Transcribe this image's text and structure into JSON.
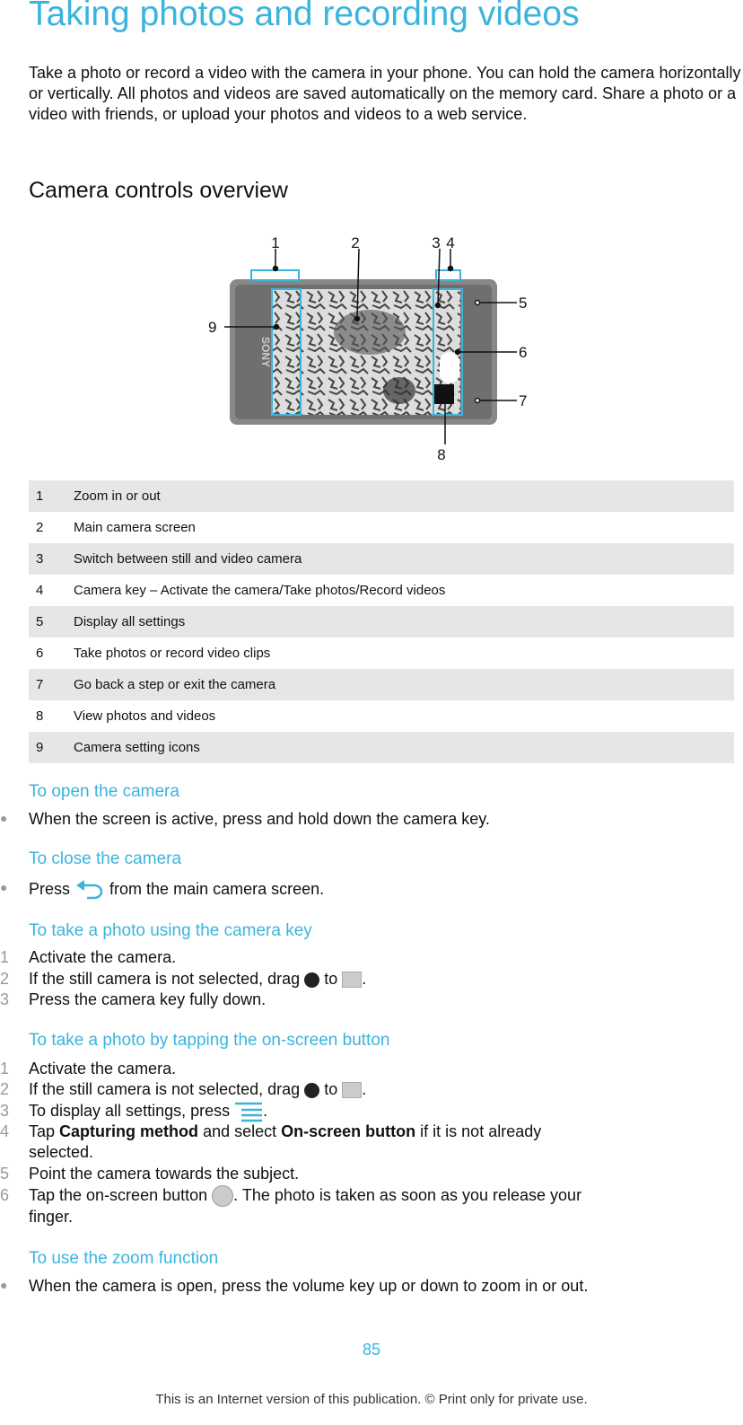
{
  "title": "Taking photos and recording videos",
  "intro": "Take a photo or record a video with the camera in your phone. You can hold the camera horizontally or vertically. All photos and videos are saved automatically on the memory card. Share a photo or a video with friends, or upload your photos and videos to a web service.",
  "overview_heading": "Camera controls overview",
  "diagram": {
    "callouts": [
      "1",
      "2",
      "3",
      "4",
      "5",
      "6",
      "7",
      "8",
      "9"
    ],
    "brand": "SONY",
    "accent": "#3bb4dc"
  },
  "legend": [
    {
      "n": "1",
      "text": "Zoom in or out"
    },
    {
      "n": "2",
      "text": "Main camera screen"
    },
    {
      "n": "3",
      "text": "Switch between still and video camera"
    },
    {
      "n": "4",
      "text": "Camera key – Activate the camera/Take photos/Record videos"
    },
    {
      "n": "5",
      "text": "Display all settings"
    },
    {
      "n": "6",
      "text": "Take photos or record video clips"
    },
    {
      "n": "7",
      "text": "Go back a step or exit the camera"
    },
    {
      "n": "8",
      "text": "View photos and videos"
    },
    {
      "n": "9",
      "text": "Camera setting icons"
    }
  ],
  "open": {
    "heading": "To open the camera",
    "bullet": "When the screen is active, press and hold down the camera key."
  },
  "close": {
    "heading": "To close the camera",
    "pre": "Press",
    "post": "from the main camera screen.",
    "icon": "back-icon"
  },
  "key": {
    "heading": "To take a photo using the camera key",
    "steps": [
      "Activate the camera.",
      "If the still camera is not selected, drag",
      "to",
      ".",
      "Press the camera key fully down."
    ],
    "nums": [
      "1",
      "2",
      "3"
    ]
  },
  "tap": {
    "heading": "To take a photo by tapping the on-screen button",
    "nums": [
      "1",
      "2",
      "3",
      "4",
      "5",
      "6"
    ],
    "s1": "Activate the camera.",
    "s2a": "If the still camera is not selected, drag",
    "s2b": "to",
    "s2c": ".",
    "s3a": "To display all settings, press",
    "s3b": ".",
    "s4a": "Tap",
    "s4b": "Capturing method",
    "s4c": "and select",
    "s4d": "On-screen button",
    "s4e": "if it is not already",
    "s4f": "selected.",
    "s5": "Point the camera towards the subject.",
    "s6a": "Tap the on-screen button",
    "s6b": ". The photo is taken as soon as you release your",
    "s6c": "finger."
  },
  "zoom": {
    "heading": "To use the zoom function",
    "bullet": "When the camera is open, press the volume key up or down to zoom in or out."
  },
  "footer": {
    "page": "85",
    "note": "This is an Internet version of this publication. © Print only for private use."
  }
}
